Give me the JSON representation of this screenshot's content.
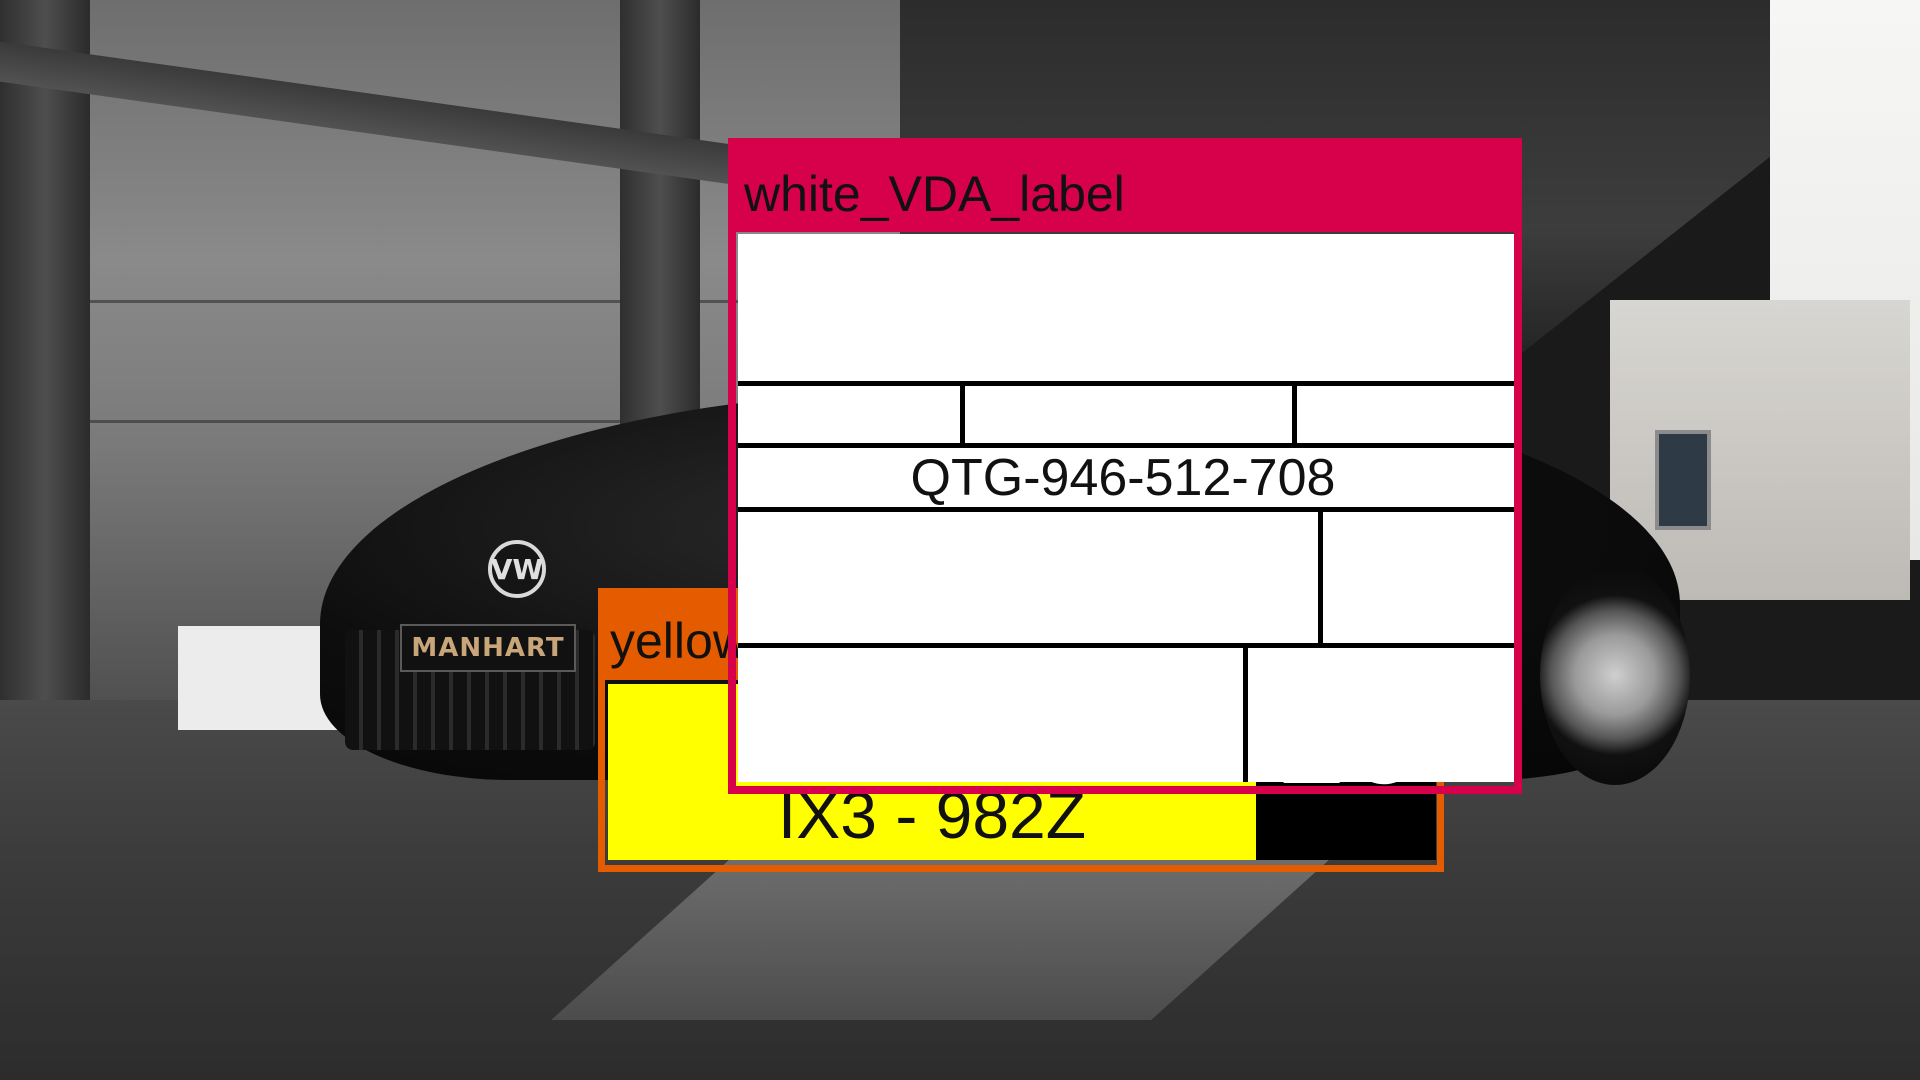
{
  "annotations": [
    {
      "label": "white_VDA_label",
      "color": "#d6004b"
    },
    {
      "label": "yellow",
      "color": "#e55c00"
    }
  ],
  "vda_label": {
    "code": "QTG-946-512-708"
  },
  "yellow_plate": {
    "text": "IX3 - 982Z",
    "side_text": "16"
  },
  "scene": {
    "car_badge": "VW",
    "car_plate": "MANHART"
  }
}
